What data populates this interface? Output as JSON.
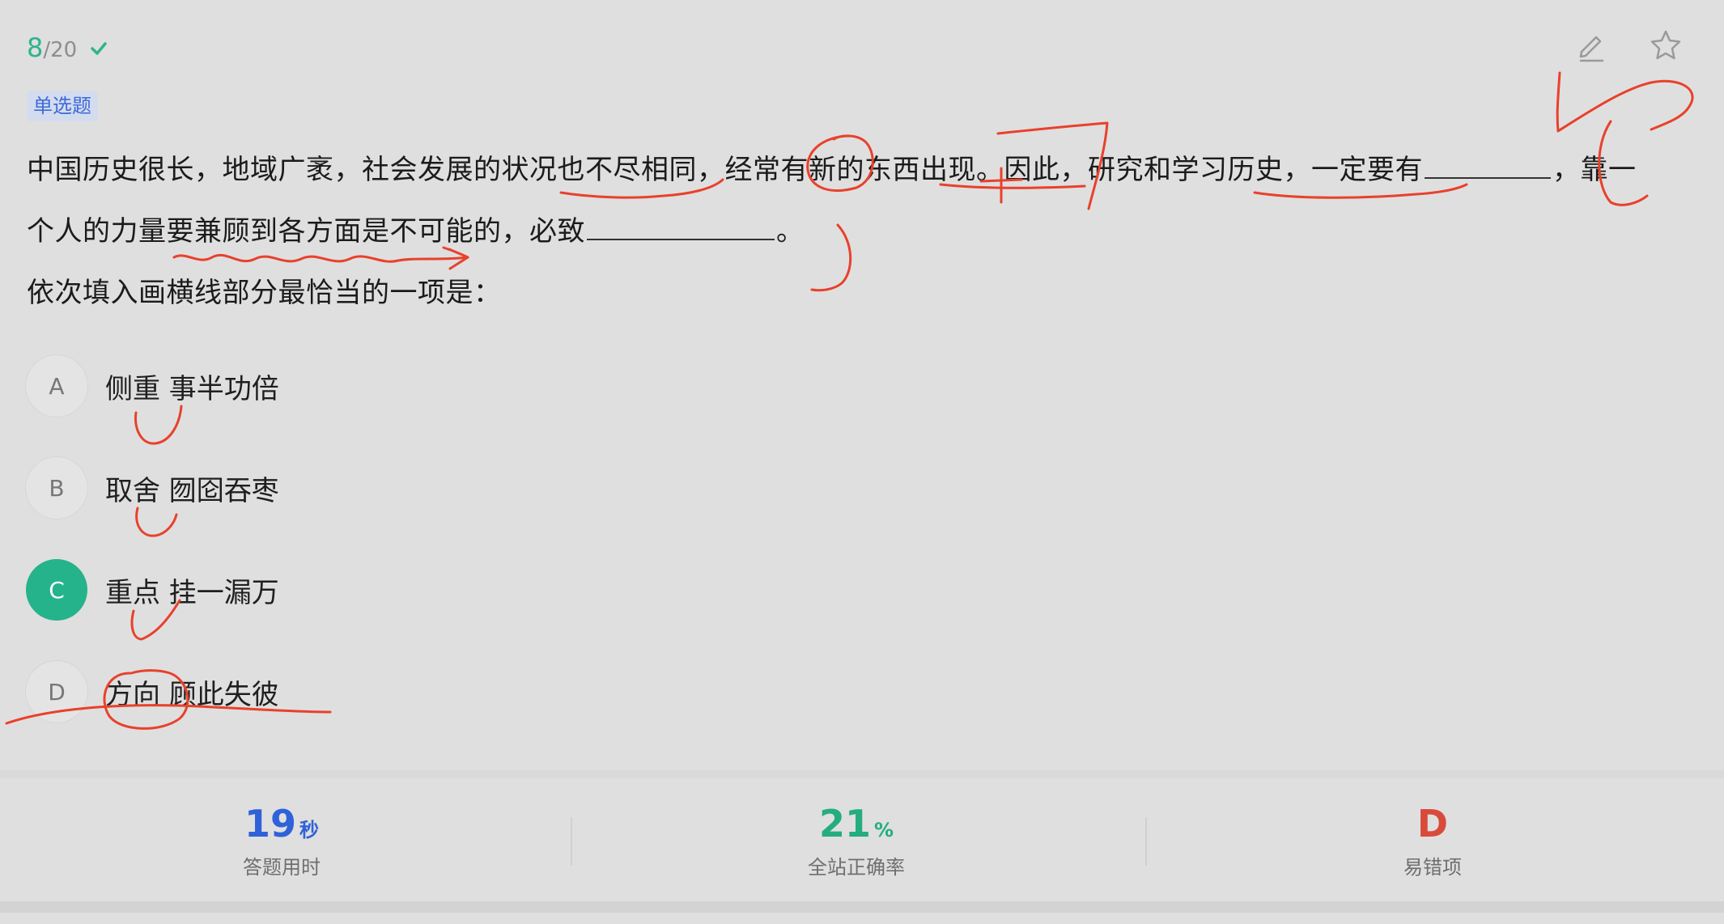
{
  "progress": {
    "current": "8",
    "separator": "/",
    "total": "20"
  },
  "question": {
    "type_badge": "单选题",
    "stem_line1_a": "中国历史很长，地域广袤，社会发展的状况也不尽相同，经常有新的东西出现。因此，研究和学习历史，一定要有",
    "stem_line1_b": "，靠一",
    "stem_line2_a": "个人的力量要兼顾到各方面是不可能的，必致",
    "stem_line2_b": "。",
    "prompt": "依次填入画横线部分最恰当的一项是："
  },
  "options": [
    {
      "letter": "A",
      "text": "侧重 事半功倍"
    },
    {
      "letter": "B",
      "text": "取舍 囫囵吞枣"
    },
    {
      "letter": "C",
      "text": "重点 挂一漏万"
    },
    {
      "letter": "D",
      "text": "方向 顾此失彼"
    }
  ],
  "stats": {
    "time_value": "19",
    "time_unit": "秒",
    "time_label": "答题用时",
    "rate_value": "21",
    "rate_unit": "%",
    "rate_label": "全站正确率",
    "error_value": "D",
    "error_label": "易错项"
  },
  "colors": {
    "accent_green": "#25b38b",
    "time_blue": "#2f62d8",
    "error_red": "#d84a3a",
    "ink_red": "#e8412c"
  },
  "icons": [
    "check-icon",
    "edit-icon",
    "star-icon"
  ]
}
